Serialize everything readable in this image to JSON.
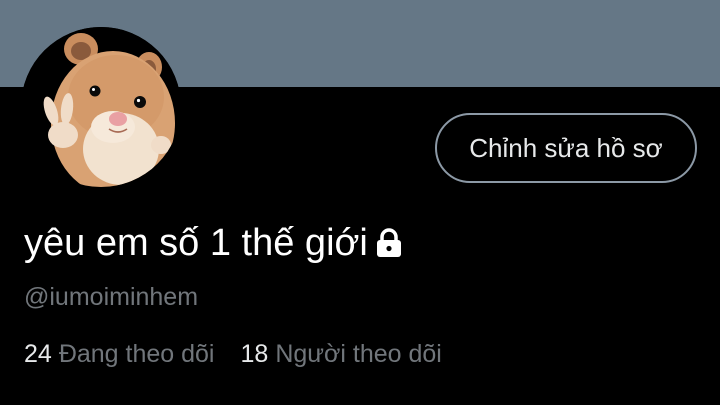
{
  "profile": {
    "display_name": "yêu em số 1 thế giới",
    "handle": "@iumoiminhem",
    "protected_icon": "lock-icon",
    "avatar": "hamster-peace-sign"
  },
  "actions": {
    "edit_profile_label": "Chỉnh sửa hồ sơ"
  },
  "stats": {
    "following_count": "24",
    "following_label": "Đang theo dõi",
    "followers_count": "18",
    "followers_label": "Người theo dõi"
  },
  "colors": {
    "banner": "#657786",
    "background": "#000000",
    "text_primary": "#ffffff",
    "text_secondary": "#71767b",
    "button_border": "#8c99a6"
  }
}
